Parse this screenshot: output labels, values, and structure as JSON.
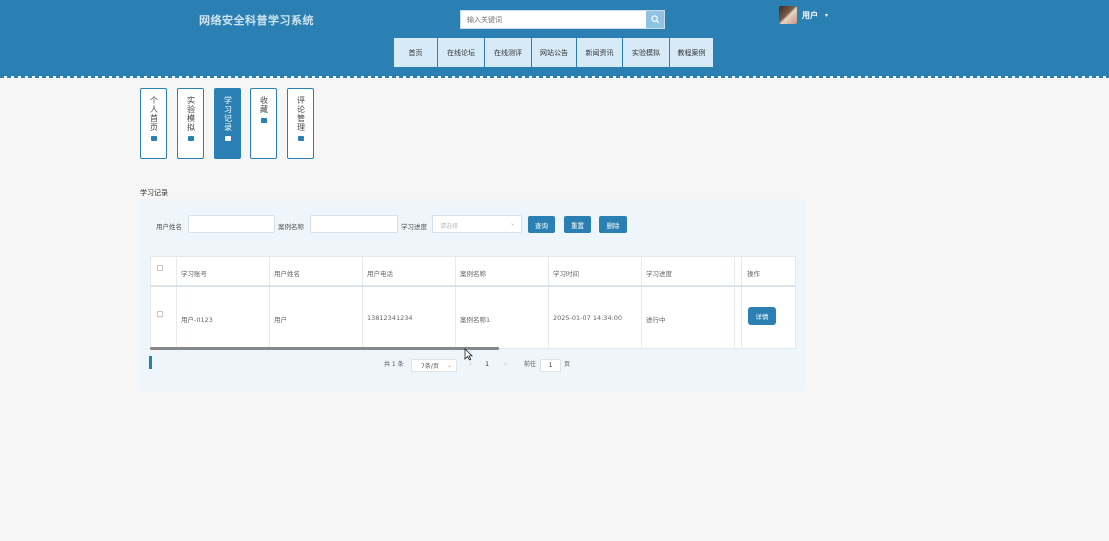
{
  "header": {
    "site_title": "网络安全科普学习系统",
    "search_placeholder": "输入关键词",
    "user_name": "用户",
    "nav": [
      "首页",
      "在线论坛",
      "在线测评",
      "网站公告",
      "新闻资讯",
      "实验模拟",
      "教程案例"
    ]
  },
  "side_tabs": [
    {
      "label": "个人首页",
      "active": false
    },
    {
      "label": "实验模拟",
      "active": false
    },
    {
      "label": "学习记录",
      "active": true
    },
    {
      "label": "收藏",
      "active": false
    },
    {
      "label": "评论管理",
      "active": false
    }
  ],
  "section_title": "学习记录",
  "filters": {
    "user_name_label": "用户姓名",
    "case_name_label": "案例名称",
    "progress_label": "学习进度",
    "progress_placeholder": "请选择",
    "query_button": "查询",
    "reset_button": "重置",
    "delete_button": "删除"
  },
  "table": {
    "headers": [
      "学习账号",
      "用户姓名",
      "用户电话",
      "案例名称",
      "学习时间",
      "学习进度",
      "操作"
    ],
    "rows": [
      {
        "account": "用户-0123",
        "name": "用户",
        "phone": "13812341234",
        "case": "案例名称1",
        "time": "2025-01-07 14:34:00",
        "progress": "进行中",
        "action": "详情"
      }
    ]
  },
  "pagination": {
    "total": "共 1 条",
    "page_size": "7条/页",
    "prev": "‹",
    "current_page": "1",
    "next": "›",
    "goto_label": "前往",
    "goto_value": "1",
    "page_unit": "页"
  },
  "colors": {
    "primary": "#2a80b2",
    "nav_bg": "#d7eaf8",
    "panel_bg": "#eef5fb",
    "page_bg": "#f6f6f6"
  },
  "icons": [
    "search-icon",
    "chevron-down-icon",
    "tab-icon"
  ]
}
